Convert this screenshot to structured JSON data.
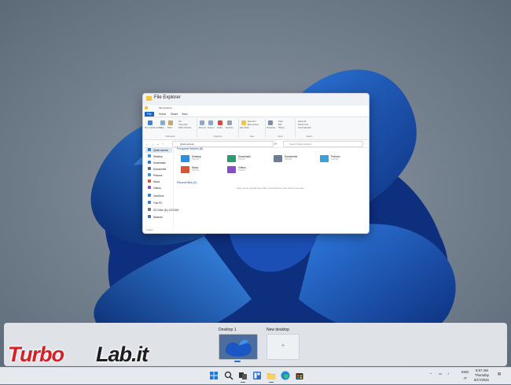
{
  "window": {
    "title": "File Explorer",
    "mini_title": "File Explorer",
    "tabs": [
      "File",
      "Home",
      "Share",
      "View"
    ],
    "ribbon": {
      "clipboard": {
        "label": "Clipboard",
        "pin": "Pin to Quick access",
        "copy": "Copy",
        "paste": "Paste",
        "cut": "Cut",
        "copy_path": "Copy path",
        "paste_shortcut": "Paste shortcut"
      },
      "organize": {
        "label": "Organize",
        "move": "Move to",
        "copy_to": "Copy to",
        "delete": "Delete",
        "rename": "Rename"
      },
      "new": {
        "label": "New",
        "folder": "New folder",
        "item": "New item",
        "easy": "Easy access"
      },
      "open": {
        "label": "Open",
        "properties": "Properties",
        "open": "Open",
        "edit": "Edit",
        "history": "History"
      },
      "select": {
        "label": "Select",
        "all": "Select all",
        "none": "Select none",
        "invert": "Invert selection"
      }
    },
    "address": "Quick access",
    "search_placeholder": "Search Quick access",
    "nav": [
      {
        "label": "Quick access",
        "color": "#2a7fd8"
      },
      {
        "label": "Desktop",
        "color": "#3b8ee0"
      },
      {
        "label": "Downloads",
        "color": "#2e7bd0"
      },
      {
        "label": "Documents",
        "color": "#5b6f8c"
      },
      {
        "label": "Pictures",
        "color": "#3a9ad9"
      },
      {
        "label": "Music",
        "color": "#d6563a"
      },
      {
        "label": "Videos",
        "color": "#8a4dc8"
      },
      {
        "label": "OneDrive",
        "color": "#2f86d6"
      },
      {
        "label": "This PC",
        "color": "#3b7fd0"
      },
      {
        "label": "CD Drive (D:) CCCOM",
        "color": "#6c7a89"
      },
      {
        "label": "Network",
        "color": "#3d6fb0"
      }
    ],
    "frequent_heading": "Frequent folders (6)",
    "folders": [
      {
        "name": "Desktop",
        "sub": "This PC",
        "color": "#2e8fe0"
      },
      {
        "name": "Downloads",
        "sub": "This PC",
        "color": "#2a9d70"
      },
      {
        "name": "Documents",
        "sub": "This PC",
        "color": "#6a7d95"
      },
      {
        "name": "Pictures",
        "sub": "This PC",
        "color": "#3aa0dc"
      },
      {
        "name": "Music",
        "sub": "This PC",
        "color": "#d6563a"
      },
      {
        "name": "Videos",
        "sub": "This PC",
        "color": "#8a4dc8"
      }
    ],
    "recent_heading": "Recent files (0)",
    "recent_empty": "After you've opened some files, we'll show the most recent ones here.",
    "status": "6 items"
  },
  "task_view": {
    "desktop1": "Desktop 1",
    "new_desktop": "New desktop",
    "plus": "+"
  },
  "watermark": {
    "part1": "Turbo",
    "part2": "Lab.it"
  },
  "taskbar": {
    "apps": [
      "start-icon",
      "search-icon",
      "task-view-icon",
      "widgets-icon",
      "file-explorer-icon",
      "edge-icon",
      "store-icon"
    ],
    "lang1": "ENG",
    "lang2": "IT",
    "time": "8:57 AM",
    "day": "Thursday",
    "date": "6/17/2021"
  }
}
